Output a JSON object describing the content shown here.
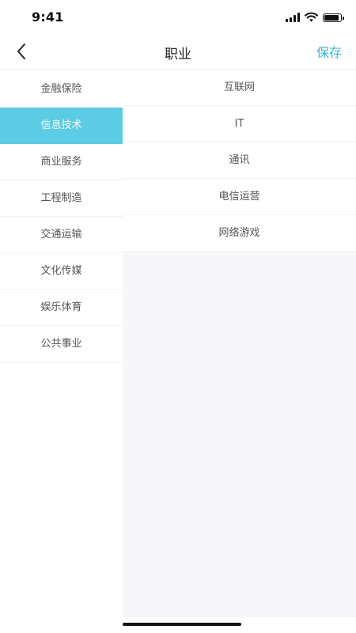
{
  "status_bar": {
    "time": "9:41",
    "icons": [
      "signal-icon",
      "wifi-icon",
      "battery-icon"
    ],
    "battery_level": 0.9
  },
  "nav_bar": {
    "back_icon": "chevron-left-icon",
    "title": "职业",
    "save_label": "保存"
  },
  "colors": {
    "accent": "#3cb6da",
    "active_background": "#5ccbe4",
    "panel_background": "#f7f7fa"
  },
  "categories": {
    "selected_index": 1,
    "items": [
      {
        "label": "金融保险"
      },
      {
        "label": "信息技术"
      },
      {
        "label": "商业服务"
      },
      {
        "label": "工程制造"
      },
      {
        "label": "交通运输"
      },
      {
        "label": "文化传媒"
      },
      {
        "label": "娱乐体育"
      },
      {
        "label": "公共事业"
      }
    ]
  },
  "subcategories": {
    "items": [
      {
        "label": "互联网"
      },
      {
        "label": "IT"
      },
      {
        "label": "通讯"
      },
      {
        "label": "电信运营"
      },
      {
        "label": "网络游戏"
      }
    ]
  }
}
